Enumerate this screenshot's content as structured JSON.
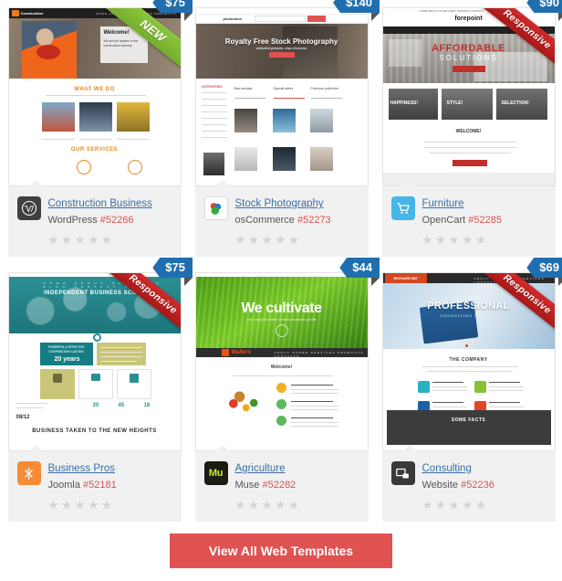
{
  "footer": {
    "cta_label": "View All Web Templates",
    "cta_color": "#e05252"
  },
  "badges": {
    "new": "NEW",
    "responsive": "Responsive",
    "new_color": "#8cc63e",
    "responsive_color": "#c02424"
  },
  "price_tag_color": "#1f6fb0",
  "cards": [
    {
      "name": "Construction Business",
      "platform": "WordPress",
      "item_number": "#52266",
      "price": "$75",
      "badge": "NEW",
      "badge_type": "new",
      "rating": 0,
      "icon": "wordpress-icon",
      "preview": {
        "brand": "Construction",
        "nav": "HOME   ABOUT US   SERVICES   PROJECTS",
        "hero_heading": "Welcome!",
        "hero_sub": "We are the leaders in the construction industry",
        "section_1": "WHAT WE DO",
        "section_2": "OUR SERVICES"
      }
    },
    {
      "name": "Stock Photography",
      "platform": "osCommerce",
      "item_number": "#52273",
      "price": "$140",
      "badge": null,
      "badge_type": null,
      "rating": 0,
      "icon": "oscommerce-icon",
      "preview": {
        "brand": "photostore",
        "hero_heading": "Royalty Free Stock Photography",
        "hero_sub": "unlimited pictures, clips of access",
        "col_1": "New arrivals",
        "col_2": "Special offers",
        "col_3": "Premium collection",
        "sidebar": "CATEGORIES"
      }
    },
    {
      "name": "Furniture",
      "platform": "OpenCart",
      "item_number": "#52285",
      "price": "$90",
      "badge": "Responsive",
      "badge_type": "responsive",
      "rating": 0,
      "icon": "opencart-icon",
      "preview": {
        "brand": "forepoint",
        "hero_heading": "AFFORDABLE",
        "hero_sub": "SOLUTIONS",
        "tile_1": "HAPPINESS!",
        "tile_2": "STYLE!",
        "tile_3": "SELECTION!",
        "welcome": "WELCOME!"
      }
    },
    {
      "name": "Business Pros",
      "platform": "Joomla",
      "item_number": "#52181",
      "price": "$75",
      "badge": "Responsive",
      "badge_type": "responsive",
      "rating": 0,
      "icon": "joomla-icon",
      "preview": {
        "hero_heading": "INDEPENDENT BUSINESS SCOPE",
        "panel_heading": "POWERFUL & EFFECTIVE COOPERATION LASTING",
        "panel_value": "20 years",
        "date": "08/12",
        "stat_1": "20",
        "stat_2": "45",
        "stat_3": "18",
        "footer_heading": "BUSINESS TAKEN TO THE NEW HEIGHTS"
      }
    },
    {
      "name": "Agriculture",
      "platform": "Muse",
      "item_number": "#52282",
      "price": "$44",
      "badge": null,
      "badge_type": null,
      "rating": 0,
      "icon": "muse-icon",
      "preview": {
        "brand": "Walters",
        "hero_heading": "We cultivate",
        "hero_sub": "new crops to make farmers increase profits",
        "nav": "ABOUT   STORE   SERVICES   PRODUCTS   CONTACTS",
        "welcome": "Welcome!"
      }
    },
    {
      "name": "Consulting",
      "platform": "Website",
      "item_number": "#52236",
      "price": "$69",
      "badge": "Responsive",
      "badge_type": "responsive",
      "rating": 0,
      "icon": "website-icon",
      "preview": {
        "brand": "RICHARD BIZ",
        "hero_heading": "PROFESSIONAL",
        "hero_sub": "CONSULTING SERVICE",
        "section_1": "THE COMPANY",
        "section_2": "SOME FACTS"
      }
    }
  ]
}
